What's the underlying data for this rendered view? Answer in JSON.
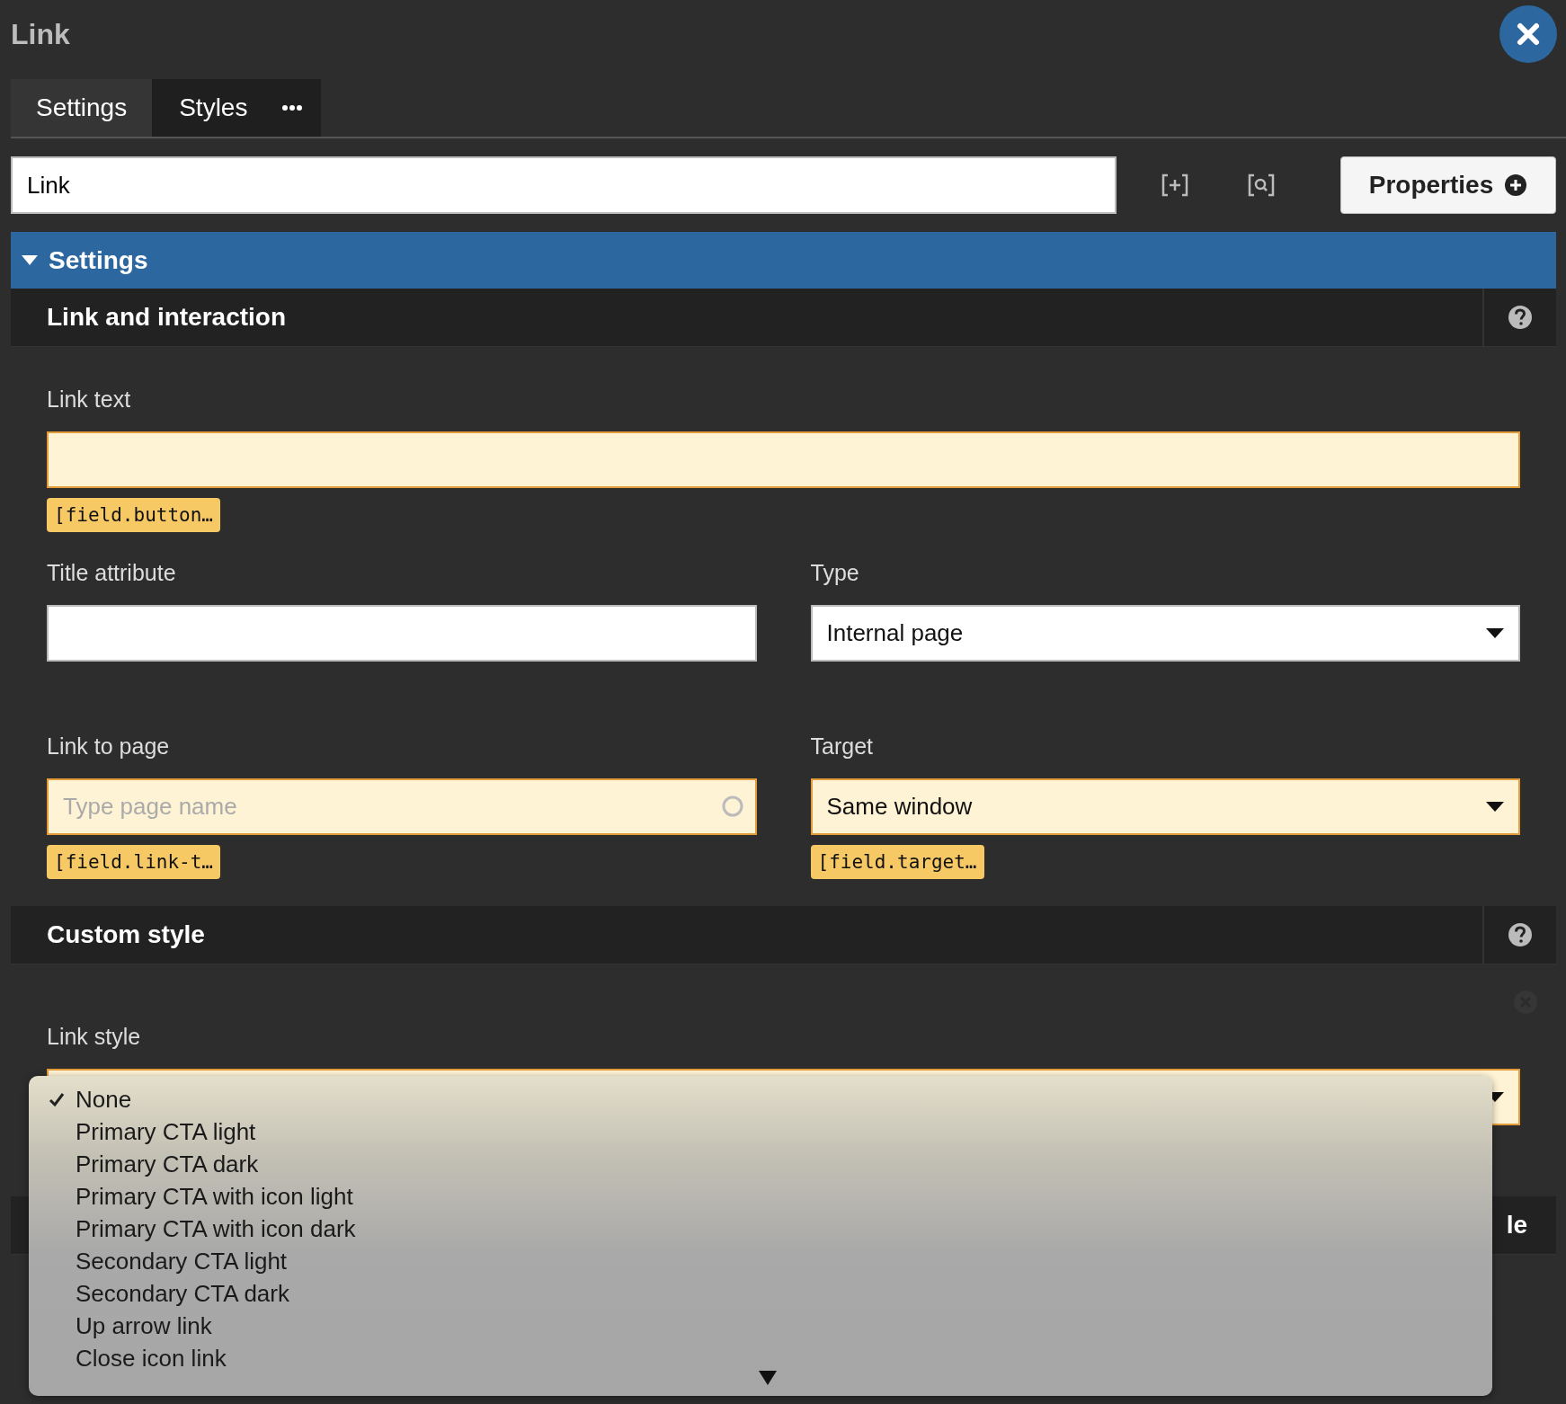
{
  "window": {
    "title": "Link"
  },
  "tabs": [
    {
      "label": "Settings",
      "selected": true
    },
    {
      "label": "Styles",
      "selected": false
    }
  ],
  "name_field": {
    "value": "Link"
  },
  "properties_button": {
    "label": "Properties"
  },
  "panel": {
    "title": "Settings",
    "expanded": true
  },
  "sections": [
    {
      "title": "Link and interaction",
      "rows": [
        [
          {
            "kind": "text",
            "label": "Link text",
            "highlighted": true,
            "tag": "[field.button…"
          }
        ],
        [
          {
            "kind": "text",
            "label": "Title attribute",
            "highlighted": false
          },
          {
            "kind": "select",
            "label": "Type",
            "value": "Internal page",
            "highlighted": false
          }
        ],
        [
          {
            "kind": "search",
            "label": "Link to page",
            "placeholder": "Type page name",
            "highlighted": true,
            "tag": "[field.link-t…"
          },
          {
            "kind": "select",
            "label": "Target",
            "value": "Same window",
            "highlighted": true,
            "tag": "[field.target…"
          }
        ]
      ]
    },
    {
      "title": "Custom style",
      "clearable": true,
      "rows": [
        [
          {
            "kind": "select",
            "label": "Link style",
            "highlighted": true
          }
        ]
      ]
    },
    {
      "title": "le"
    }
  ],
  "dropdown": {
    "options": [
      {
        "label": "None",
        "selected": true
      },
      {
        "label": "Primary CTA light",
        "selected": false
      },
      {
        "label": "Primary CTA dark",
        "selected": false
      },
      {
        "label": "Primary CTA with icon light",
        "selected": false
      },
      {
        "label": "Primary CTA with icon dark",
        "selected": false
      },
      {
        "label": "Secondary CTA light",
        "selected": false
      },
      {
        "label": "Secondary CTA dark",
        "selected": false
      },
      {
        "label": "Up arrow link",
        "selected": false
      },
      {
        "label": "Close icon link",
        "selected": false
      }
    ]
  }
}
